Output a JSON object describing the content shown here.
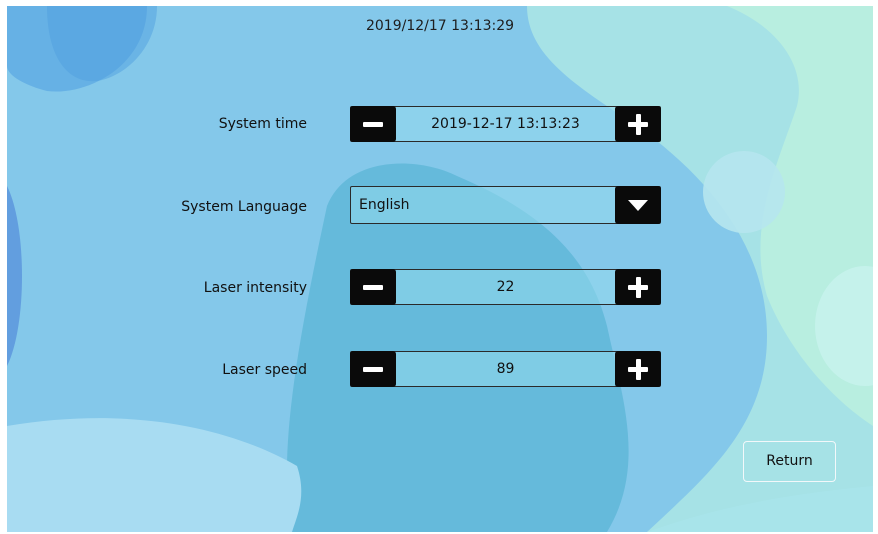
{
  "header": {
    "clock": "2019/12/17 13:13:29"
  },
  "settings": {
    "system_time": {
      "label": "System time",
      "value": "2019-12-17 13:13:23"
    },
    "system_language": {
      "label": "System Language",
      "value": "English"
    },
    "laser_intensity": {
      "label": "Laser intensity",
      "value": "22"
    },
    "laser_speed": {
      "label": "Laser speed",
      "value": "89"
    }
  },
  "footer": {
    "return_label": "Return"
  },
  "icons": {
    "decrement": "minus-icon",
    "increment": "plus-icon",
    "dropdown": "triangle-down-icon"
  },
  "colors": {
    "control_button": "#0a0a0a",
    "control_glyph": "#ffffff"
  }
}
